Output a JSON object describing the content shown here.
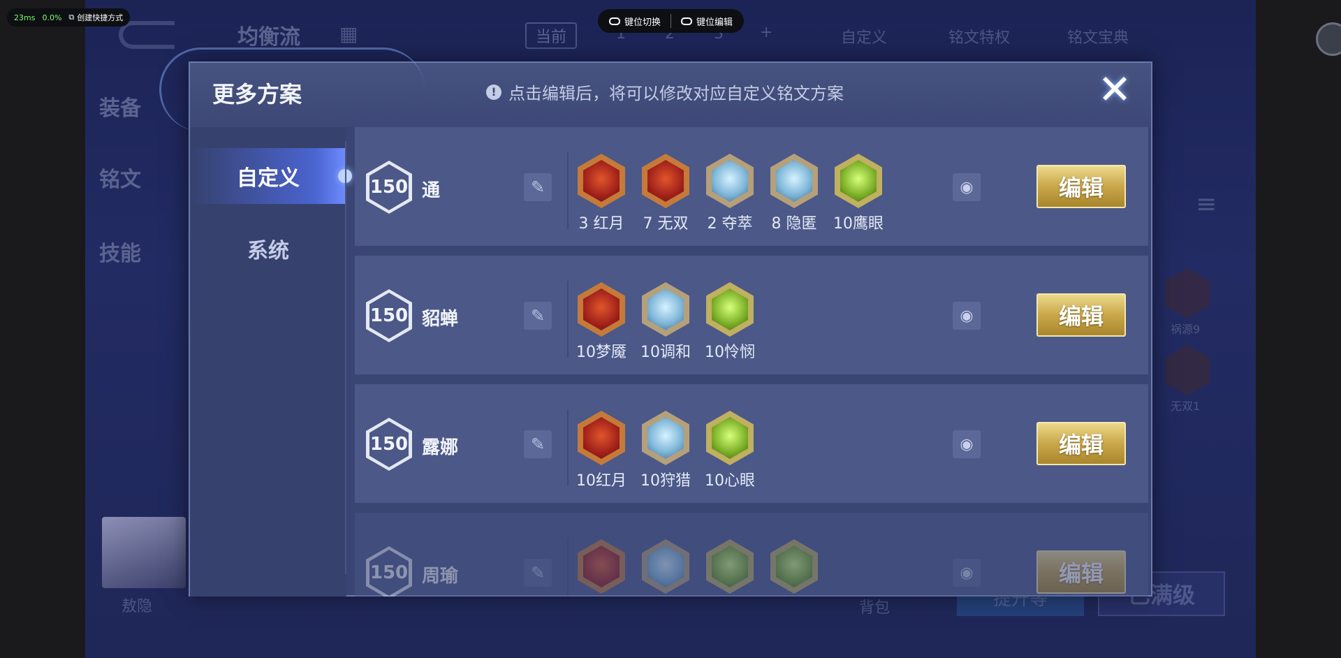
{
  "emulator": {
    "latency": "23ms",
    "cpu": "0.0%",
    "shortcut_label": "创建快捷方式",
    "keymap_switch": "键位切换",
    "keymap_edit": "键位编辑"
  },
  "background": {
    "scheme_title": "均衡流",
    "tab_current": "当前",
    "scheme_numbers": [
      "1",
      "2",
      "3"
    ],
    "add_symbol": "+",
    "custom_link": "自定义",
    "rune_privilege": "铭文特权",
    "rune_codex": "铭文宝典",
    "side_equipment": "装备",
    "side_rune": "铭文",
    "side_skill": "技能",
    "hero_name": "敖隐",
    "bag_label": "背包",
    "upgrade_label": "提升等",
    "max_level_label": "已满级",
    "right_rune_1": "祸源9",
    "right_rune_2": "无双1"
  },
  "modal": {
    "title": "更多方案",
    "tip": "点击编辑后，将可以修改对应自定义铭文方案",
    "close_symbol": "✕",
    "tabs": {
      "custom": "自定义",
      "system": "系统"
    },
    "edit_label": "编辑",
    "schemes": [
      {
        "level": "150",
        "name": "通",
        "runes": [
          {
            "label": "3 红月",
            "color": "red"
          },
          {
            "label": "7 无双",
            "color": "red"
          },
          {
            "label": "2 夺萃",
            "color": "blue"
          },
          {
            "label": "8 隐匿",
            "color": "blue"
          },
          {
            "label": "10鹰眼",
            "color": "green"
          }
        ]
      },
      {
        "level": "150",
        "name": "貂蝉",
        "runes": [
          {
            "label": "10梦魇",
            "color": "red"
          },
          {
            "label": "10调和",
            "color": "blue"
          },
          {
            "label": "10怜悯",
            "color": "green"
          }
        ]
      },
      {
        "level": "150",
        "name": "露娜",
        "runes": [
          {
            "label": "10红月",
            "color": "red"
          },
          {
            "label": "10狩猎",
            "color": "blue"
          },
          {
            "label": "10心眼",
            "color": "green"
          }
        ]
      },
      {
        "level": "150",
        "name": "周瑜",
        "runes": [
          {
            "label": "",
            "color": "red"
          },
          {
            "label": "",
            "color": "blue"
          },
          {
            "label": "",
            "color": "green"
          },
          {
            "label": "",
            "color": "green"
          }
        ]
      }
    ]
  },
  "colors": {
    "gold_button": "#c9a74a",
    "modal_bg": "#3a4573",
    "row_bg": "#4b5888"
  }
}
